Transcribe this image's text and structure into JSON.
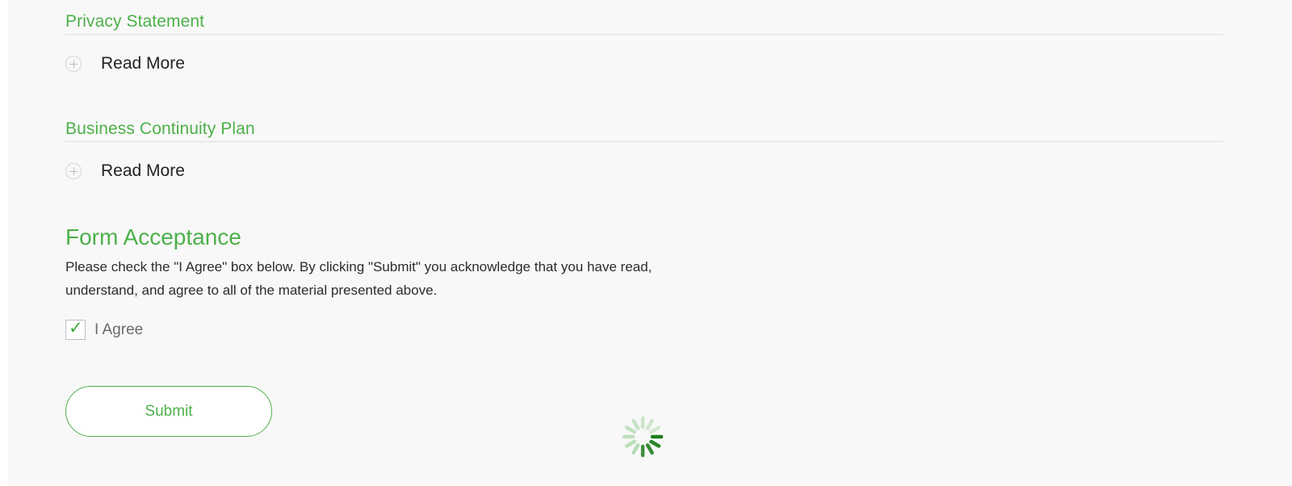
{
  "sections": [
    {
      "title": "Privacy Statement",
      "read_more_label": "Read More"
    },
    {
      "title": "Business Continuity Plan",
      "read_more_label": "Read More"
    }
  ],
  "form": {
    "heading": "Form Acceptance",
    "description": "Please check the \"I Agree\" box below. By clicking \"Submit\" you acknowledge that you have read, understand, and agree to all of the material presented above.",
    "agree_label": "I Agree",
    "agree_checked": true,
    "submit_label": "Submit"
  },
  "loading": {
    "icon": "loading-spinner-icon",
    "active": true
  },
  "colors": {
    "accent": "#4db04a",
    "spinner_dark": "#1f7f1c",
    "spinner_light": "#a7d6a5",
    "background": "#f8f8f8"
  }
}
